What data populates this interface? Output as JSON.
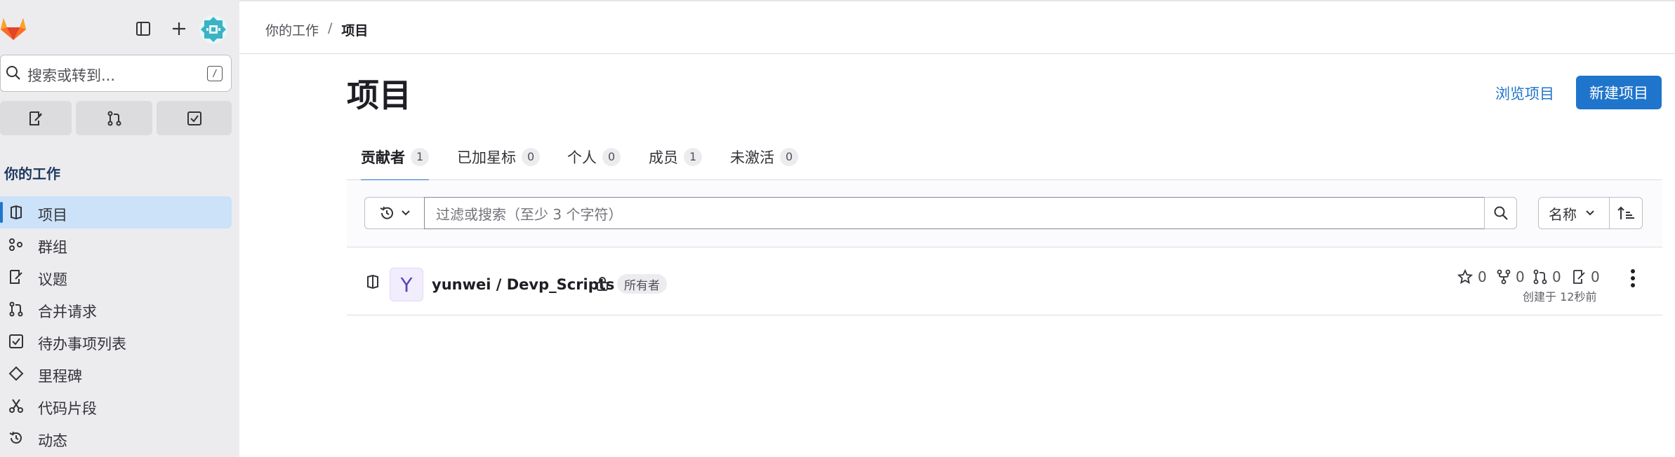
{
  "colors": {
    "accent": "#1f75cb",
    "sidebar_bg": "#ececef",
    "active_nav_bg": "#cbe2f9",
    "logo_orange": "#e24329",
    "avatar_teal": "#3ab3c5"
  },
  "sidebar": {
    "search": {
      "placeholder": "搜索或转到...",
      "shortcut": "/"
    },
    "top_icons": [
      "gitlab-logo",
      "sidebar-toggle-icon",
      "plus-icon",
      "user-avatar"
    ],
    "quick_actions": [
      "issues-icon",
      "merge-request-icon",
      "todo-icon"
    ],
    "heading": "你的工作",
    "items": [
      {
        "label": "项目",
        "icon": "project-icon",
        "active": true
      },
      {
        "label": "群组",
        "icon": "group-icon"
      },
      {
        "label": "议题",
        "icon": "issues-icon"
      },
      {
        "label": "合并请求",
        "icon": "merge-request-icon"
      },
      {
        "label": "待办事项列表",
        "icon": "todo-icon"
      },
      {
        "label": "里程碑",
        "icon": "milestone-icon"
      },
      {
        "label": "代码片段",
        "icon": "snippet-icon"
      },
      {
        "label": "动态",
        "icon": "history-icon"
      }
    ]
  },
  "breadcrumb": {
    "parent": "你的工作",
    "separator": "/",
    "current": "项目"
  },
  "header": {
    "title": "项目",
    "explore_label": "浏览项目",
    "new_label": "新建项目"
  },
  "tabs": [
    {
      "label": "贡献者",
      "count": "1",
      "active": true
    },
    {
      "label": "已加星标",
      "count": "0"
    },
    {
      "label": "个人",
      "count": "0"
    },
    {
      "label": "成员",
      "count": "1"
    },
    {
      "label": "未激活",
      "count": "0"
    }
  ],
  "filter": {
    "placeholder": "过滤或搜索（至少 3 个字符）",
    "sort_label": "名称"
  },
  "projects": [
    {
      "avatar_letter": "Y",
      "name": "yunwei / Devp_Scripts",
      "role": "所有者",
      "stars": "0",
      "forks": "0",
      "merge_requests": "0",
      "issues": "0",
      "created": "创建于 12秒前"
    }
  ]
}
